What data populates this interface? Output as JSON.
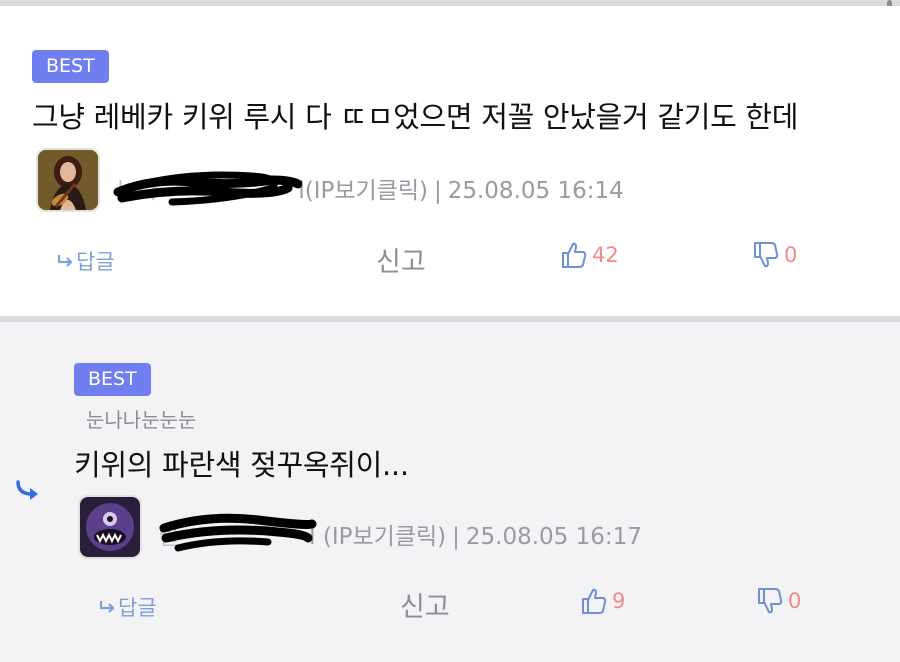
{
  "comments": [
    {
      "badge": "BEST",
      "text": "그냥 레베카 키위 루시 다 ㄸㅁ었으면 저꼴 안났을거 같기도 한데",
      "nickname": "누나",
      "ip_tag": "l(IP보기클릭)",
      "separator": "|",
      "timestamp": "25.08.05 16:14",
      "reply_label": "답글",
      "report_label": "신고",
      "likes": "42",
      "dislikes": "0"
    },
    {
      "badge": "BEST",
      "reply_to": "눈나나눈눈눈",
      "text": "키위의 파란색 젖꾸옥쥐이...",
      "nickname": "밀",
      "ip_tag": "l (IP보기클릭)",
      "separator": "|",
      "timestamp": "25.08.05 16:17",
      "reply_label": "답글",
      "report_label": "신고",
      "likes": "9",
      "dislikes": "0"
    }
  ],
  "colors": {
    "badge": "#6f7ff0",
    "accent_blue": "#6f8fd8",
    "count_red": "#f08a8a",
    "reply_bg": "#f3f3f5"
  },
  "icons": [
    "reply-arrow-icon",
    "thumbs-up-icon",
    "thumbs-down-icon",
    "nested-reply-arrow-icon"
  ]
}
